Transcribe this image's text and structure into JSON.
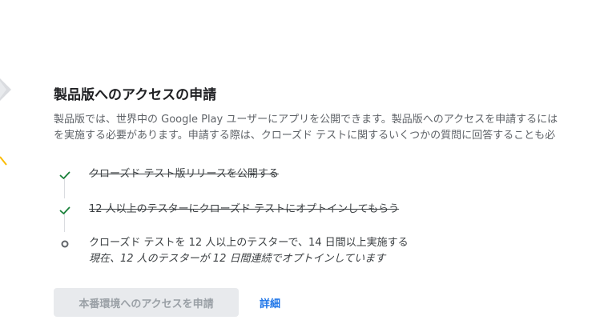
{
  "section": {
    "title": "製品版へのアクセスの申請",
    "description_line1": "製品版では、世界中の Google Play ユーザーにアプリを公開できます。製品版へのアクセスを申請するには",
    "description_line2": "を実施する必要があります。申請する際は、クローズド テストに関するいくつかの質問に回答することも必"
  },
  "steps": [
    {
      "label": "クローズド テスト版リリースを公開する",
      "status": "complete",
      "icon": "check-icon"
    },
    {
      "label": "12 人以上のテスターにクローズド テストにオプトインしてもらう",
      "status": "complete",
      "icon": "check-icon"
    },
    {
      "label": "クローズド テストを 12 人以上のテスターで、14 日間以上実施する",
      "sublabel": "現在、12 人のテスターが 12 日間連続でオプトインしています",
      "status": "in-progress",
      "icon": "circle-icon"
    }
  ],
  "actions": {
    "request_button_label": "本番環境へのアクセスを申請",
    "request_button_enabled": false,
    "details_link_label": "詳細"
  },
  "colors": {
    "check": "#188038",
    "pending": "#5f6368",
    "link": "#1a73e8",
    "disabled_bg": "#e8eaed",
    "disabled_text": "#9aa0a6"
  }
}
